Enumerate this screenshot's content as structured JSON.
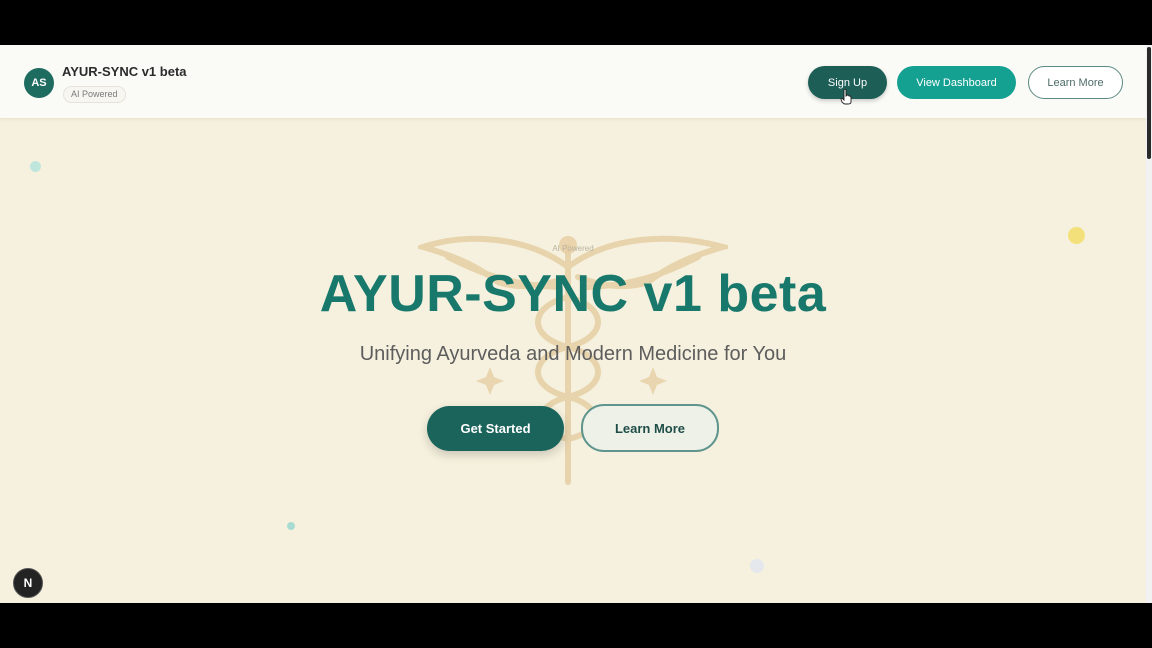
{
  "header": {
    "logo_initials": "AS",
    "title": "AYUR-SYNC v1 beta",
    "chip": "AI Powered",
    "signup_label": "Sign Up",
    "dashboard_label": "View Dashboard",
    "learn_more_label": "Learn More"
  },
  "hero": {
    "chip": "AI Powered",
    "title": "AYUR-SYNC v1 beta",
    "subtitle": "Unifying Ayurveda and Modern Medicine for You",
    "primary_button": "Get Started",
    "secondary_button": "Learn More"
  },
  "dev_badge": "N",
  "colors": {
    "accent": "#18786c",
    "primary_dark": "#1d5e57",
    "teal": "#15a192",
    "background": "#f6f1de"
  },
  "icons": {
    "background": "caduceus-icon",
    "dev": "nextjs-icon"
  }
}
